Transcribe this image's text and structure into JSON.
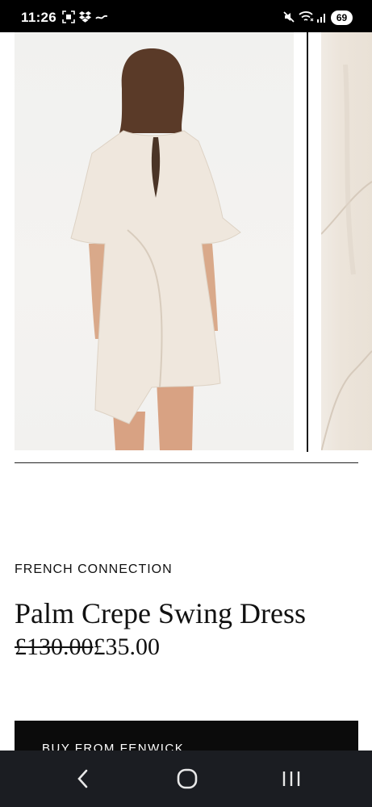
{
  "status_bar": {
    "time": "11:26",
    "battery": "69",
    "icons": [
      "screenshot-icon",
      "dropbox-icon",
      "app-icon",
      "mute-icon",
      "wifi-icon",
      "signal-icon"
    ]
  },
  "gallery": {
    "images": [
      "dress-back-view-photo",
      "dress-detail-photo"
    ]
  },
  "product": {
    "brand": "FRENCH CONNECTION",
    "title": "Palm Crepe Swing Dress",
    "price_old": "£130.00",
    "price_new": "£35.00",
    "buy_label": "BUY FROM FENWICK"
  },
  "nav": {
    "icons": [
      "back-icon",
      "home-icon",
      "recents-icon"
    ]
  },
  "colors": {
    "status_bar": "#000000",
    "nav_bar": "#1b1d22",
    "button": "#0b0b0b",
    "dress": "#efe7dd"
  }
}
